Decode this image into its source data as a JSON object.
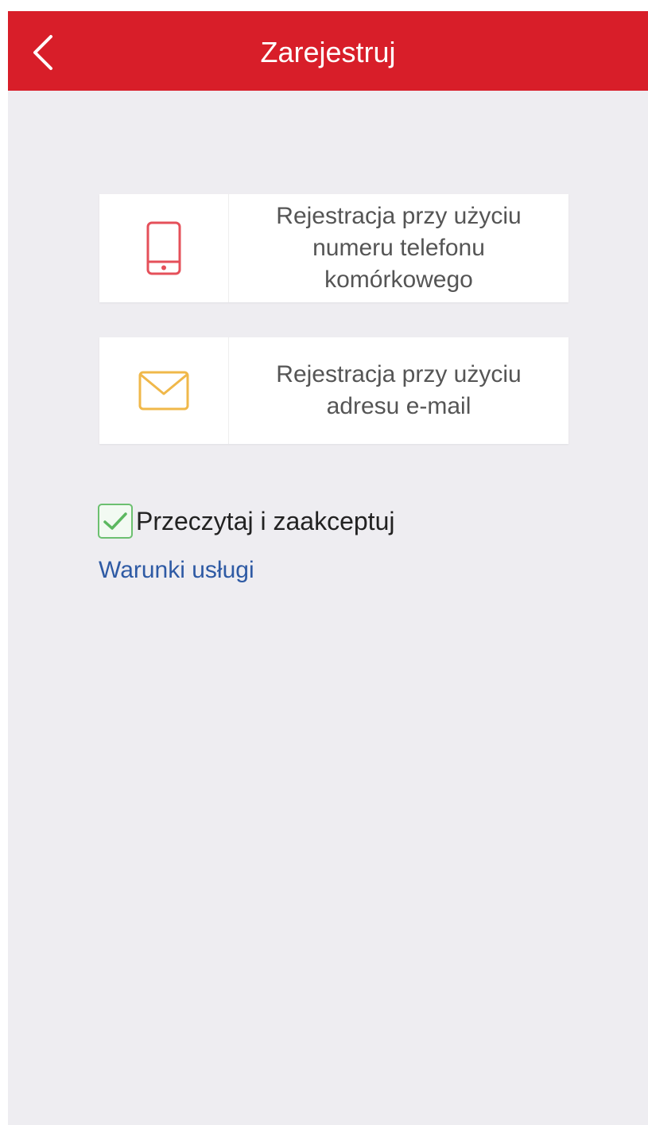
{
  "header": {
    "title": "Zarejestruj",
    "back_icon": "chevron-left-icon",
    "background_color": "#d81e29"
  },
  "options": [
    {
      "icon": "mobile-phone-icon",
      "icon_color": "#e5505a",
      "label_lines": [
        "Rejestracja przy użyciu",
        "numeru telefonu",
        "komórkowego"
      ]
    },
    {
      "icon": "envelope-icon",
      "icon_color": "#f0b84a",
      "label_lines": [
        "Rejestracja przy użyciu",
        "adresu e-mail"
      ]
    }
  ],
  "agreement": {
    "checked": true,
    "label": "Przeczytaj i zaakceptuj",
    "link_text": "Warunki usługi",
    "link_color": "#2e5aa4",
    "check_color": "#5cb860"
  }
}
